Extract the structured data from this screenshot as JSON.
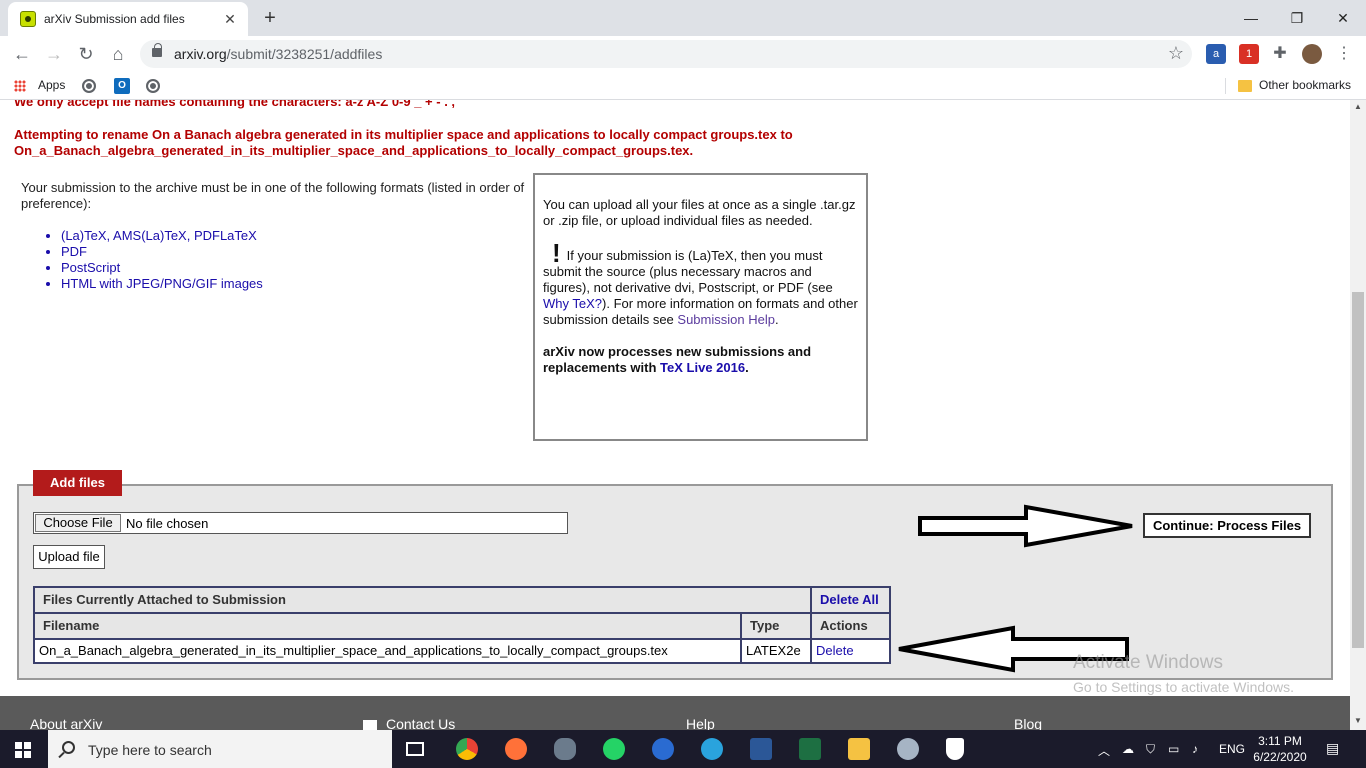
{
  "browser": {
    "tab_title": "arXiv Submission add files",
    "url_host": "arxiv.org",
    "url_path": "/submit/3238251/addfiles",
    "bookmarks": {
      "apps_label": "Apps",
      "other_bookmarks": "Other bookmarks"
    }
  },
  "page": {
    "cut_warning": "We only accept file names containing the characters: a-z A-Z 0-9 _ + - . ,",
    "rename_warning": "Attempting to rename On a Banach algebra generated in its multiplier space and applications to locally compact groups.tex to On_a_Banach_algebra_generated_in_its_multiplier_space_and_applications_to_locally_compact_groups.tex.",
    "formats_intro": "Your submission to the archive must be in one of the following formats (listed in order of preference):",
    "formats": [
      "(La)TeX, AMS(La)TeX, PDFLaTeX",
      "PDF",
      "PostScript",
      "HTML with JPEG/PNG/GIF images"
    ],
    "info": {
      "upload_note": "You can upload all your files at once as a single .tar.gz or .zip file, or upload individual files as needed.",
      "bang": "!",
      "latex_note_1": "If your submission is (La)TeX, then you must submit the source (plus necessary macros and figures), not derivative dvi, Postscript, or PDF (see ",
      "why_tex_link": "Why TeX?",
      "latex_note_2": "). For more information on formats and other submission details see ",
      "help_link": "Submission Help",
      "latex_note_3": ".",
      "texlive_prefix": "arXiv now processes new submissions and replacements with ",
      "texlive_link": "TeX Live 2016",
      "texlive_suffix": "."
    },
    "add_files": {
      "legend": "Add files",
      "choose_file": "Choose File",
      "no_file": "No file chosen",
      "upload_button": "Upload file",
      "continue_button": "Continue: Process Files"
    },
    "files_table": {
      "title": "Files Currently Attached to Submission",
      "delete_all": "Delete All",
      "headers": [
        "Filename",
        "Type",
        "Actions"
      ],
      "rows": [
        {
          "filename": "On_a_Banach_algebra_generated_in_its_multiplier_space_and_applications_to_locally_compact_groups.tex",
          "type": "LATEX2e",
          "action": "Delete"
        }
      ]
    },
    "footer": [
      "About arXiv",
      "Contact Us",
      "Help",
      "Blog"
    ],
    "watermark": {
      "line1": "Activate Windows",
      "line2": "Go to Settings to activate Windows."
    }
  },
  "taskbar": {
    "search_placeholder": "Type here to search",
    "language": "ENG",
    "time": "3:11 PM",
    "date": "6/22/2020"
  },
  "colors": {
    "legend_red": "#b31b1b",
    "warning_red": "#b30000",
    "link_blue": "#1a0dab"
  }
}
